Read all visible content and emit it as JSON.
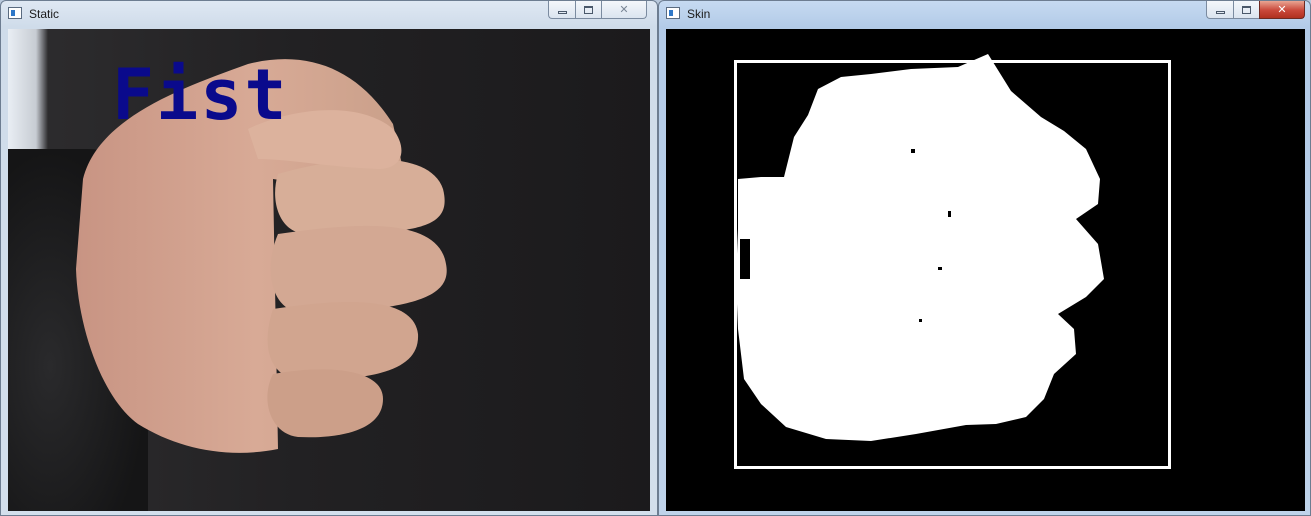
{
  "windows": {
    "static": {
      "title": "Static",
      "overlay_label": "Fist",
      "overlay_color": "#0a0a8c"
    },
    "skin": {
      "title": "Skin"
    }
  },
  "caption_buttons": {
    "minimize_icon": "minimize-icon",
    "maximize_icon": "maximize-icon",
    "close_icon": "close-icon",
    "close_glyph": "✕"
  },
  "colors": {
    "mask_background": "#000000",
    "mask_foreground": "#ffffff",
    "close_active": "#c9483a"
  }
}
